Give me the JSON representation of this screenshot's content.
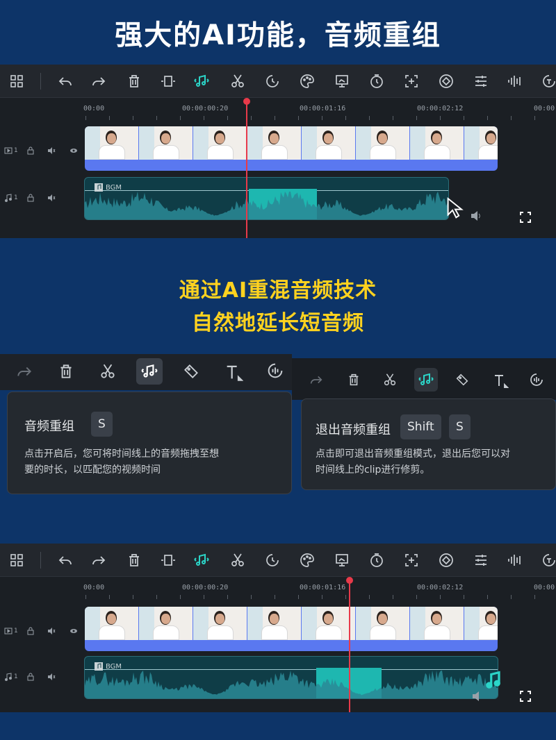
{
  "headline": "强大的AI功能，音频重组",
  "subtitle_line1": "通过AI重混音频技术",
  "subtitle_line2": "自然地延长短音频",
  "toolbar_icons": [
    "layout-grid-icon",
    "undo-icon",
    "redo-icon",
    "delete-icon",
    "crop-icon",
    "audio-remix-icon",
    "scissors-icon",
    "speed-icon",
    "color-palette-icon",
    "export-frame-icon",
    "timer-icon",
    "add-marker-icon",
    "keyframe-icon",
    "adjust-icon",
    "audio-wave-icon",
    "speech-to-text-icon"
  ],
  "timeline_top": {
    "ruler": [
      "00:00",
      "00:00:00:20",
      "00:00:01:16",
      "00:00:02:12",
      "00:00"
    ],
    "audio_clip_label": "BGM",
    "track_video_num": "1",
    "track_audio_num": "1"
  },
  "timeline_bottom": {
    "ruler": [
      "00:00",
      "00:00:00:20",
      "00:00:01:16",
      "00:00:02:12",
      "00:00"
    ],
    "audio_clip_label": "BGM",
    "track_video_num": "1",
    "track_audio_num": "1"
  },
  "tooltip_left": {
    "title": "音频重组",
    "shortcut": "S",
    "body_line1": "点击开启后，您可将时间线上的音频拖拽至想",
    "body_line2": "要的时长，以匹配您的视频时间"
  },
  "tooltip_right": {
    "title": "退出音频重组",
    "shortcut1": "Shift",
    "shortcut2": "S",
    "body_line1": "点击即可退出音频重组模式，退出后您可以对",
    "body_line2": "时间线上的clip进行修剪。"
  },
  "colors": {
    "background": "#0d3468",
    "accent_cyan": "#2bd5c8",
    "subtitle_yellow": "#ffd21f",
    "playhead_red": "#e83a4a",
    "video_clip_blue": "#5a78f0"
  }
}
